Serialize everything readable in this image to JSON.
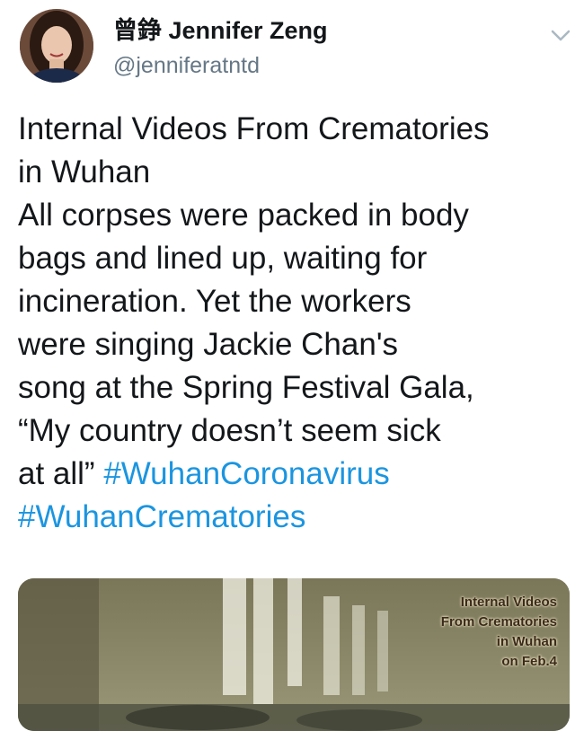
{
  "author": {
    "display_name": "曾錚 Jennifer Zeng",
    "handle": "@jenniferatntd"
  },
  "icons": {
    "avatar": "profile-photo",
    "menu": "chevron-down-icon"
  },
  "tweet": {
    "lines": [
      "Internal Videos From Crematories",
      "in Wuhan",
      "All corpses were packed in body",
      "bags and lined up, waiting for",
      "incineration. Yet the workers",
      "were singing Jackie Chan's",
      "song at the Spring Festival Gala,",
      "“My country doesn’t seem sick"
    ],
    "last_line_prefix": "at all” ",
    "hashtag_1": "#WuhanCoronavirus",
    "hashtag_2": "#WuhanCrematories"
  },
  "media": {
    "overlay_lines": [
      "Internal Videos",
      "From Crematories",
      "in Wuhan",
      "on Feb.4"
    ]
  },
  "colors": {
    "hashtag": "#1b95e0",
    "handle": "#657786",
    "text": "#14171a"
  }
}
